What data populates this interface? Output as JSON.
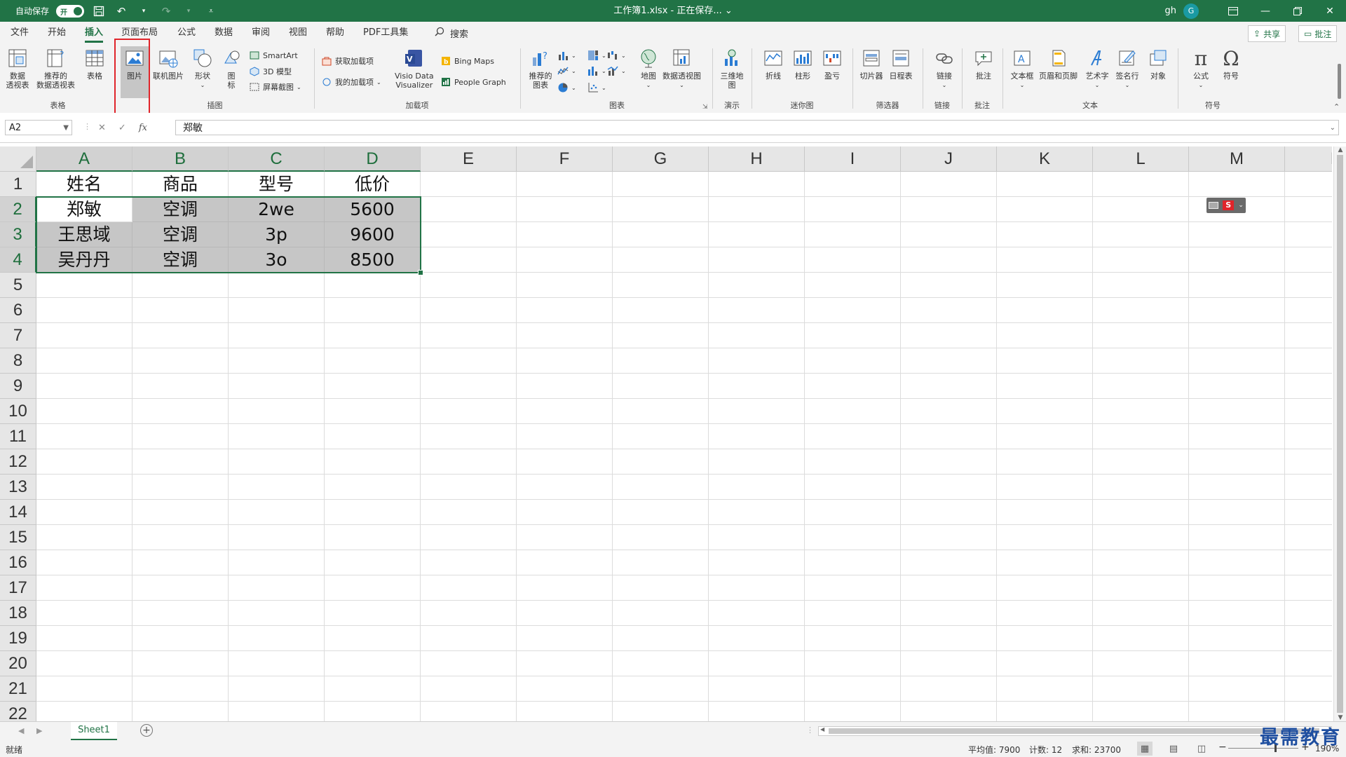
{
  "titlebar": {
    "autosave_label": "自动保存",
    "autosave_state": "开",
    "title": "工作簿1.xlsx - 正在保存... ⌄",
    "user": "gh",
    "avatar_initial": "G"
  },
  "tabs": [
    "文件",
    "开始",
    "插入",
    "页面布局",
    "公式",
    "数据",
    "审阅",
    "视图",
    "帮助",
    "PDF工具集"
  ],
  "active_tab": "插入",
  "search_label": "搜索",
  "share_label": "共享",
  "comment_label": "批注",
  "ribbon": {
    "groups": {
      "tables": "表格",
      "illustrations": "插图",
      "addins": "加载项",
      "charts": "图表",
      "tours": "演示",
      "sparklines": "迷你图",
      "filters": "筛选器",
      "links": "链接",
      "comments": "批注",
      "text": "文本",
      "symbols": "符号"
    },
    "buttons": {
      "pivot_line1": "数据",
      "pivot_line2": "透视表",
      "rec_pivot_line1": "推荐的",
      "rec_pivot_line2": "数据透视表",
      "table": "表格",
      "picture": "图片",
      "online_picture": "联机图片",
      "shapes": "形状",
      "icons_line1": "图",
      "icons_line2": "标",
      "smartart": "SmartArt",
      "model3d": "3D 模型",
      "screenshot": "屏幕截图",
      "get_addins": "获取加载项",
      "my_addins": "我的加载项",
      "visio_line1": "Visio Data",
      "visio_line2": "Visualizer",
      "bing_maps": "Bing Maps",
      "people_graph": "People Graph",
      "rec_charts_line1": "推荐的",
      "rec_charts_line2": "图表",
      "maps": "地图",
      "pivot_chart": "数据透视图",
      "map3d_line1": "三维地",
      "map3d_line2": "图",
      "spark_line": "折线",
      "spark_column": "柱形",
      "spark_winloss": "盈亏",
      "slicer": "切片器",
      "timeline": "日程表",
      "link": "链接",
      "comment": "批注",
      "textbox": "文本框",
      "header_footer": "页眉和页脚",
      "wordart": "艺术字",
      "signature": "签名行",
      "object": "对象",
      "equation": "公式",
      "symbol": "符号"
    }
  },
  "formula_bar": {
    "name_box": "A2",
    "content": "郑敏"
  },
  "columns": [
    "A",
    "B",
    "C",
    "D",
    "E",
    "F",
    "G",
    "H",
    "I",
    "J",
    "K",
    "L",
    "M",
    "I"
  ],
  "rows": [
    "1",
    "2",
    "3",
    "4",
    "5",
    "6",
    "7",
    "8",
    "9",
    "10",
    "11",
    "12",
    "13",
    "14",
    "15",
    "16",
    "17",
    "18",
    "19",
    "20",
    "21",
    "22"
  ],
  "table": {
    "header": [
      "姓名",
      "商品",
      "型号",
      "低价"
    ],
    "data": [
      [
        "郑敏",
        "空调",
        "2we",
        "5600"
      ],
      [
        "王思域",
        "空调",
        "3p",
        "9600"
      ],
      [
        "吴丹丹",
        "空调",
        "3o",
        "8500"
      ]
    ]
  },
  "sheet_tab": "Sheet1",
  "status": {
    "ready": "就绪",
    "average": "平均值: 7900",
    "count": "计数: 12",
    "sum": "求和: 23700",
    "zoom": "190%"
  },
  "watermark": "最需教育",
  "colors": {
    "accent": "#217346",
    "highlight": "#e0242a",
    "selection_fill": "#c6c6c6"
  }
}
